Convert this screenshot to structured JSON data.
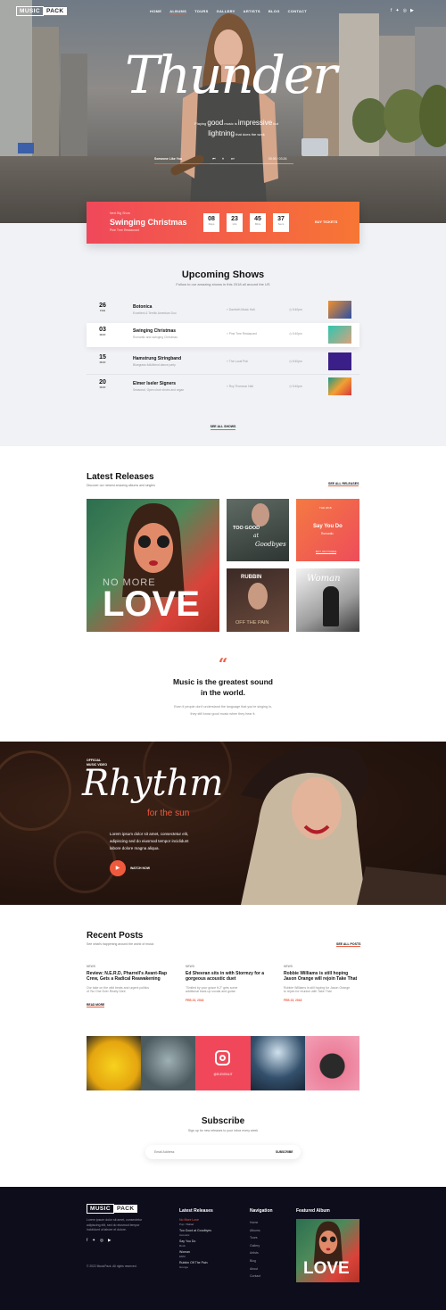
{
  "brand": {
    "logo_part1": "MUSIC",
    "logo_part2": "PACK"
  },
  "nav": {
    "items": [
      "HOME",
      "ALBUMS",
      "TOURS",
      "GALLERY",
      "ARTISTS",
      "BLOG",
      "CONTACT"
    ]
  },
  "social_icons": [
    "facebook-icon",
    "twitter-icon",
    "instagram-icon",
    "youtube-icon"
  ],
  "hero": {
    "script_title": "Thunder",
    "tagline_parts": [
      "Playing",
      "good",
      "music is",
      "impressive",
      "but",
      "lightning",
      "that does the work"
    ],
    "player": {
      "track": "Someone Like You",
      "time": "00:00 / 03:26"
    }
  },
  "countdown": {
    "kicker": "Next Big Show",
    "title": "Swinging Christmas",
    "venue": "Pine Tree Restaurant",
    "units": [
      {
        "value": "08",
        "label": "Days"
      },
      {
        "value": "23",
        "label": "Hrs"
      },
      {
        "value": "45",
        "label": "Mins"
      },
      {
        "value": "37",
        "label": "Secs"
      }
    ],
    "button": "BUY TICKETS"
  },
  "shows": {
    "title": "Upcoming Shows",
    "subtitle": "Follow to our amazing shows in this 2018 all around the US",
    "rows": [
      {
        "day": "26",
        "month": "FEB",
        "title": "Botonica",
        "sub": "Excellent & Terrific American Duo",
        "venue": "Danforth Music Hall",
        "time": "5:40pm"
      },
      {
        "day": "03",
        "month": "MAR",
        "title": "Swinging Christmas",
        "sub": "Romantic and swinging Christmas",
        "venue": "Pine Tree Restaurant",
        "time": "5:40pm"
      },
      {
        "day": "15",
        "month": "MAR",
        "title": "Hamstrung Stringband",
        "sub": "Bluegrass folk/blend dance party",
        "venue": "The Local Pub",
        "time": "8:40pm"
      },
      {
        "day": "20",
        "month": "MAR",
        "title": "Elmer Iseler Signers",
        "sub": "Seasonal, Open choir choirs and organ",
        "venue": "Roy Thomson Hall",
        "time": "5:40pm"
      }
    ],
    "see_all": "SEE ALL SHOWS"
  },
  "releases": {
    "title": "Latest Releases",
    "subtitle": "Discover our newest amazing albums and singles",
    "see_all": "SEE ALL RELEASES",
    "covers": [
      {
        "top": "NO MORE",
        "big": "LOVE"
      },
      {
        "line1": "TOO GOOD",
        "line2": "at",
        "line3": "Goodbyes"
      },
      {
        "kicker": "THE 2018",
        "title": "Say You Do",
        "sub": "Romantic",
        "cta": "BUY ON ITUNES"
      },
      {
        "line1": "RUBBIN",
        "line2": "OFF THE PAIN"
      },
      {
        "title": "Woman"
      }
    ]
  },
  "quote": {
    "mark": "“",
    "line1": "Music is the greatest sound",
    "line2": "in the world.",
    "body1": "Even if people don't understand the language that you're singing in,",
    "body2": "they still know good music when they hear it."
  },
  "video": {
    "kicker1": "OFFICIAL",
    "kicker2": "MUSIC VIDEO",
    "script_title": "Rhythm",
    "subtitle": "for the sun",
    "body1": "Lorem ipsum dolor sit amet, consectetur elit,",
    "body2": "adipiscing sed do eiusmod tempor incididunt",
    "body3": "labore dolore magna aliqua.",
    "cta": "WATCH NOW"
  },
  "posts": {
    "title": "Recent Posts",
    "subtitle": "See what's happening around the world of music",
    "see_all": "SEE ALL POSTS",
    "items": [
      {
        "cat": "NEWS",
        "title": "Review: N.E.R.D, Pharrell's Avant-Rap Crew, Gets a Radical Reawakening",
        "ex1": "Our take on the wild beats and urgent politics",
        "ex2": "of 'No One Ever Really Dies'",
        "date": "",
        "read": "READ MORE"
      },
      {
        "cat": "NEWS",
        "title": "Ed Sheeran sits in with Stormzy for a gorgeous acoustic duet",
        "ex1": "\"Smiled by your grace ft.2\" gets some",
        "ex2": "additional back-up vocals and guitar",
        "date": "FEB 23, 2018",
        "read": ""
      },
      {
        "cat": "NEWS",
        "title": "Robbie Williams is still hoping Jason Orange will rejoin Take That",
        "ex1": "Robbie Williams is still hoping for Jason Orange",
        "ex2": "to rejoin for reunion with Take That",
        "date": "FEB 23, 2018",
        "read": ""
      }
    ]
  },
  "instagram": {
    "handle": "@ELEVENLIT"
  },
  "subscribe": {
    "title": "Subscribe",
    "subtitle": "Sign up for new releases to your inbox every week",
    "placeholder": "Email Address",
    "button": "SUBSCRIBE"
  },
  "footer": {
    "about1": "Lorem ipsum dolor sit amet, consectetur",
    "about2": "adipiscing elit, sed do eiusmod tempor",
    "about3": "incididunt ut labore et dolore.",
    "copyright": "© 2022 MusicPack. All rights reserved.",
    "releases_title": "Latest Releases",
    "releases": [
      {
        "t": "No More Love",
        "s": "Pop / Ballad"
      },
      {
        "t": "Too Good at Goodbyes",
        "s": "Acoustic"
      },
      {
        "t": "Say You Do",
        "s": "Rock"
      },
      {
        "t": "Woman",
        "s": "EDM"
      },
      {
        "t": "Rubbin Off The Pain",
        "s": "Grunge"
      }
    ],
    "nav_title": "Navigation",
    "nav": [
      "Home",
      "Albums",
      "Tours",
      "Gallery",
      "Artists",
      "Blog",
      "About",
      "Contact"
    ],
    "featured_title": "Featured Album",
    "featured_big": "LOVE"
  },
  "colors": {
    "accent": "#f05a3c",
    "gradient_start": "#f0485a",
    "gradient_end": "#f77634",
    "footer_bg": "#0d0d1c"
  }
}
